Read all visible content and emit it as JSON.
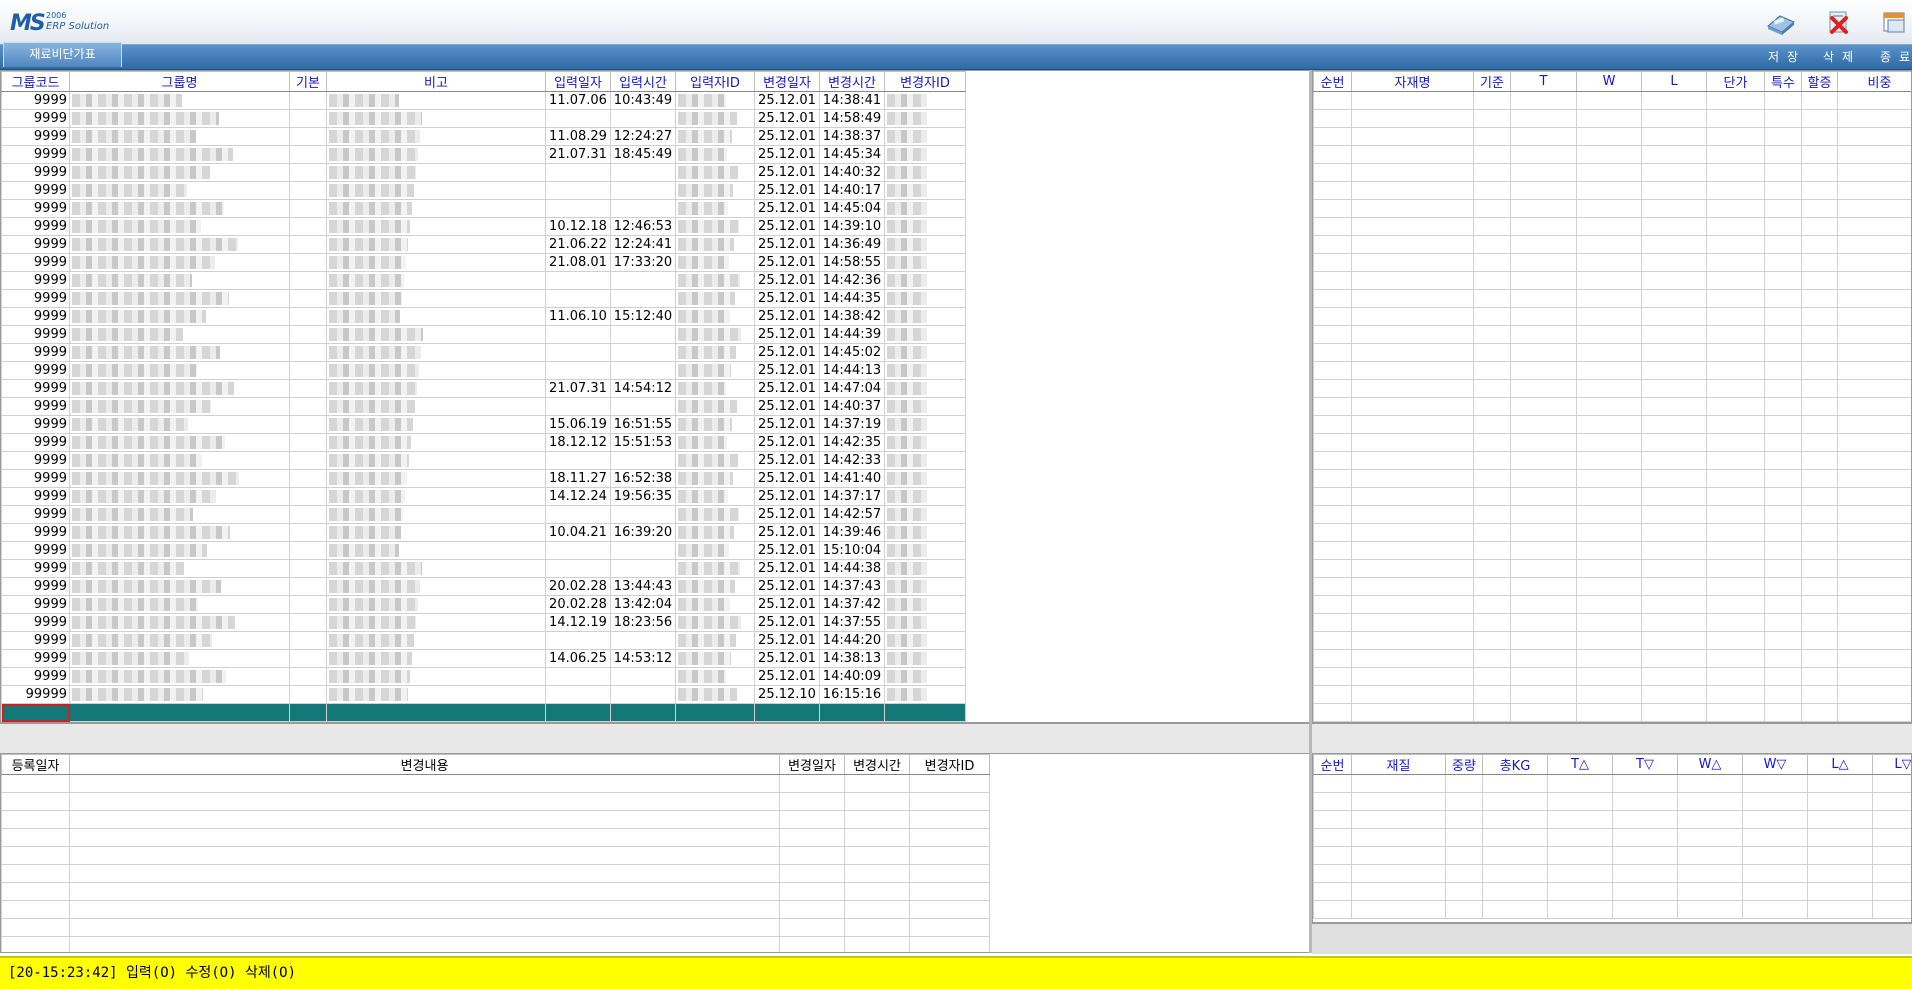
{
  "app": {
    "logo": {
      "brand": "MS",
      "year": "2006",
      "product": "ERP Solution"
    },
    "screen_tab": "재료비단가표",
    "toolbar": {
      "save_label": "저장",
      "delete_label": "삭제",
      "exit_label": "종료"
    }
  },
  "colors": {
    "selection_row": "#157878",
    "status_bg": "#ffff00",
    "header_text": "#1515d0",
    "menubar": "#3d7ab5"
  },
  "main_grid": {
    "columns": [
      "그룹코드",
      "그룹명",
      "기본",
      "비고",
      "입력일자",
      "입력시간",
      "입력자ID",
      "변경일자",
      "변경시간",
      "변경자ID"
    ],
    "rows": [
      {
        "code": "9999",
        "in_date": "11.07.06",
        "in_time": "10:43:49",
        "mod_date": "25.12.01",
        "mod_time": "14:38:41"
      },
      {
        "code": "9999",
        "in_date": "",
        "in_time": "",
        "mod_date": "25.12.01",
        "mod_time": "14:58:49"
      },
      {
        "code": "9999",
        "in_date": "11.08.29",
        "in_time": "12:24:27",
        "mod_date": "25.12.01",
        "mod_time": "14:38:37"
      },
      {
        "code": "9999",
        "in_date": "21.07.31",
        "in_time": "18:45:49",
        "mod_date": "25.12.01",
        "mod_time": "14:45:34"
      },
      {
        "code": "9999",
        "in_date": "",
        "in_time": "",
        "mod_date": "25.12.01",
        "mod_time": "14:40:32"
      },
      {
        "code": "9999",
        "in_date": "",
        "in_time": "",
        "mod_date": "25.12.01",
        "mod_time": "14:40:17"
      },
      {
        "code": "9999",
        "in_date": "",
        "in_time": "",
        "mod_date": "25.12.01",
        "mod_time": "14:45:04"
      },
      {
        "code": "9999",
        "in_date": "10.12.18",
        "in_time": "12:46:53",
        "mod_date": "25.12.01",
        "mod_time": "14:39:10"
      },
      {
        "code": "9999",
        "in_date": "21.06.22",
        "in_time": "12:24:41",
        "mod_date": "25.12.01",
        "mod_time": "14:36:49"
      },
      {
        "code": "9999",
        "in_date": "21.08.01",
        "in_time": "17:33:20",
        "mod_date": "25.12.01",
        "mod_time": "14:58:55"
      },
      {
        "code": "9999",
        "in_date": "",
        "in_time": "",
        "mod_date": "25.12.01",
        "mod_time": "14:42:36"
      },
      {
        "code": "9999",
        "in_date": "",
        "in_time": "",
        "mod_date": "25.12.01",
        "mod_time": "14:44:35"
      },
      {
        "code": "9999",
        "in_date": "11.06.10",
        "in_time": "15:12:40",
        "mod_date": "25.12.01",
        "mod_time": "14:38:42"
      },
      {
        "code": "9999",
        "in_date": "",
        "in_time": "",
        "mod_date": "25.12.01",
        "mod_time": "14:44:39"
      },
      {
        "code": "9999",
        "in_date": "",
        "in_time": "",
        "mod_date": "25.12.01",
        "mod_time": "14:45:02"
      },
      {
        "code": "9999",
        "in_date": "",
        "in_time": "",
        "mod_date": "25.12.01",
        "mod_time": "14:44:13"
      },
      {
        "code": "9999",
        "in_date": "21.07.31",
        "in_time": "14:54:12",
        "mod_date": "25.12.01",
        "mod_time": "14:47:04"
      },
      {
        "code": "9999",
        "in_date": "",
        "in_time": "",
        "mod_date": "25.12.01",
        "mod_time": "14:40:37"
      },
      {
        "code": "9999",
        "in_date": "15.06.19",
        "in_time": "16:51:55",
        "mod_date": "25.12.01",
        "mod_time": "14:37:19"
      },
      {
        "code": "9999",
        "in_date": "18.12.12",
        "in_time": "15:51:53",
        "mod_date": "25.12.01",
        "mod_time": "14:42:35"
      },
      {
        "code": "9999",
        "in_date": "",
        "in_time": "",
        "mod_date": "25.12.01",
        "mod_time": "14:42:33"
      },
      {
        "code": "9999",
        "in_date": "18.11.27",
        "in_time": "16:52:38",
        "mod_date": "25.12.01",
        "mod_time": "14:41:40"
      },
      {
        "code": "9999",
        "in_date": "14.12.24",
        "in_time": "19:56:35",
        "mod_date": "25.12.01",
        "mod_time": "14:37:17"
      },
      {
        "code": "9999",
        "in_date": "",
        "in_time": "",
        "mod_date": "25.12.01",
        "mod_time": "14:42:57"
      },
      {
        "code": "9999",
        "in_date": "10.04.21",
        "in_time": "16:39:20",
        "mod_date": "25.12.01",
        "mod_time": "14:39:46"
      },
      {
        "code": "9999",
        "in_date": "",
        "in_time": "",
        "mod_date": "25.12.01",
        "mod_time": "15:10:04"
      },
      {
        "code": "9999",
        "in_date": "",
        "in_time": "",
        "mod_date": "25.12.01",
        "mod_time": "14:44:38"
      },
      {
        "code": "9999",
        "in_date": "20.02.28",
        "in_time": "13:44:43",
        "mod_date": "25.12.01",
        "mod_time": "14:37:43"
      },
      {
        "code": "9999",
        "in_date": "20.02.28",
        "in_time": "13:42:04",
        "mod_date": "25.12.01",
        "mod_time": "14:37:42"
      },
      {
        "code": "9999",
        "in_date": "14.12.19",
        "in_time": "18:23:56",
        "mod_date": "25.12.01",
        "mod_time": "14:37:55"
      },
      {
        "code": "9999",
        "in_date": "",
        "in_time": "",
        "mod_date": "25.12.01",
        "mod_time": "14:44:20"
      },
      {
        "code": "9999",
        "in_date": "14.06.25",
        "in_time": "14:53:12",
        "mod_date": "25.12.01",
        "mod_time": "14:38:13"
      },
      {
        "code": "9999",
        "in_date": "",
        "in_time": "",
        "mod_date": "25.12.01",
        "mod_time": "14:40:09"
      },
      {
        "code": "99999",
        "in_date": "",
        "in_time": "",
        "mod_date": "25.12.10",
        "mod_time": "16:15:16"
      }
    ]
  },
  "material_grid": {
    "columns": [
      "순번",
      "자재명",
      "기준",
      "T",
      "W",
      "L",
      "단가",
      "특수",
      "할증",
      "비중"
    ]
  },
  "history_grid": {
    "columns": [
      "등록일자",
      "변경내용",
      "변경일자",
      "변경시간",
      "변경자ID"
    ]
  },
  "spec_grid": {
    "columns": [
      "순번",
      "재질",
      "중량",
      "총KG",
      "T△",
      "T▽",
      "W△",
      "W▽",
      "L△",
      "L▽"
    ]
  },
  "status": {
    "message": "[20-15:23:42] 입력(O) 수정(O) 삭제(O)"
  }
}
